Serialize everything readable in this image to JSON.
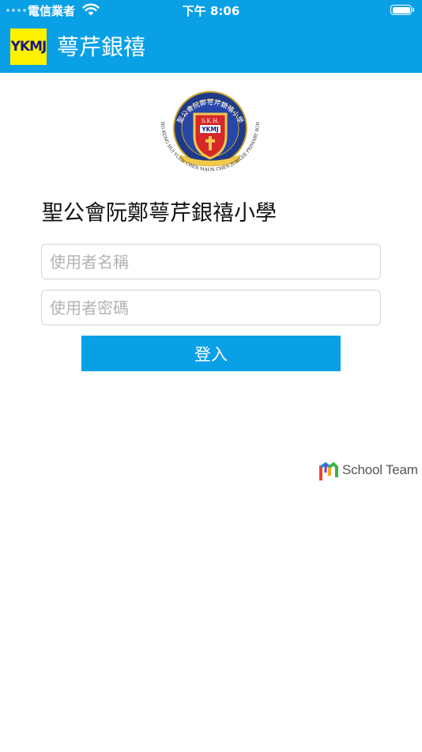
{
  "status_bar": {
    "carrier": "電信業者",
    "time": "下午 8:06",
    "wifi_icon": "wifi-icon",
    "battery_icon": "battery-icon"
  },
  "nav": {
    "logo_text": "YKMJ",
    "title": "萼芹銀禧",
    "bar_color": "#0aa0e6",
    "logo_color": "#fff200"
  },
  "crest": {
    "top_text": "聖公會阮鄭萼芹銀禧小學",
    "shield_text": "S.K.H.",
    "shield_logo": "YKMJ",
    "bottom_text": "SHENG KUNG HUI YUEN CHEN MAUN CHEN JUBILEE PRIMARY SCHOOL"
  },
  "school_name": "聖公會阮鄭萼芹銀禧小學",
  "login": {
    "username_placeholder": "使用者名稱",
    "password_placeholder": "使用者密碼",
    "username_value": "",
    "password_value": "",
    "button_label": "登入",
    "button_color": "#0aa0e6"
  },
  "vendor": {
    "name": "School Team",
    "icon": "school-team-logo-icon"
  }
}
